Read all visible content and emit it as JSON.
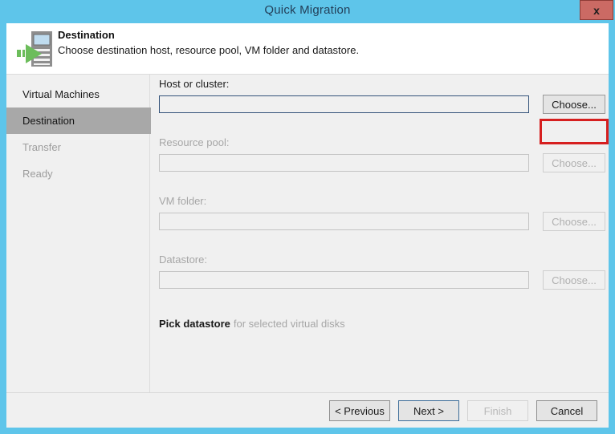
{
  "window": {
    "title": "Quick Migration",
    "close_label": "x",
    "accent_color": "#5ec5ea"
  },
  "header": {
    "icon": "server-migration-icon",
    "title": "Destination",
    "subtitle": "Choose destination host, resource pool, VM folder and datastore."
  },
  "sidebar": {
    "items": [
      {
        "label": "Virtual Machines",
        "state": "done"
      },
      {
        "label": "Destination",
        "state": "active"
      },
      {
        "label": "Transfer",
        "state": "pending"
      },
      {
        "label": "Ready",
        "state": "pending"
      }
    ]
  },
  "main": {
    "fields": [
      {
        "label": "Host or cluster:",
        "value": "",
        "placeholder": "",
        "button_label": "Choose...",
        "enabled": true,
        "highlighted": true
      },
      {
        "label": "Resource pool:",
        "value": "",
        "placeholder": "",
        "button_label": "Choose...",
        "enabled": false,
        "highlighted": false
      },
      {
        "label": "VM folder:",
        "value": "",
        "placeholder": "",
        "button_label": "Choose...",
        "enabled": false,
        "highlighted": false
      },
      {
        "label": "Datastore:",
        "value": "",
        "placeholder": "",
        "button_label": "Choose...",
        "enabled": false,
        "highlighted": false
      }
    ],
    "pick_datastore_link": "Pick datastore",
    "pick_datastore_suffix": "for selected virtual disks"
  },
  "footer": {
    "previous_label": "< Previous",
    "next_label": "Next >",
    "finish_label": "Finish",
    "cancel_label": "Cancel"
  },
  "colors": {
    "highlight_red": "#d61f1f",
    "titlebar": "#5ec5ea",
    "selected_nav": "#a8a8a8"
  }
}
